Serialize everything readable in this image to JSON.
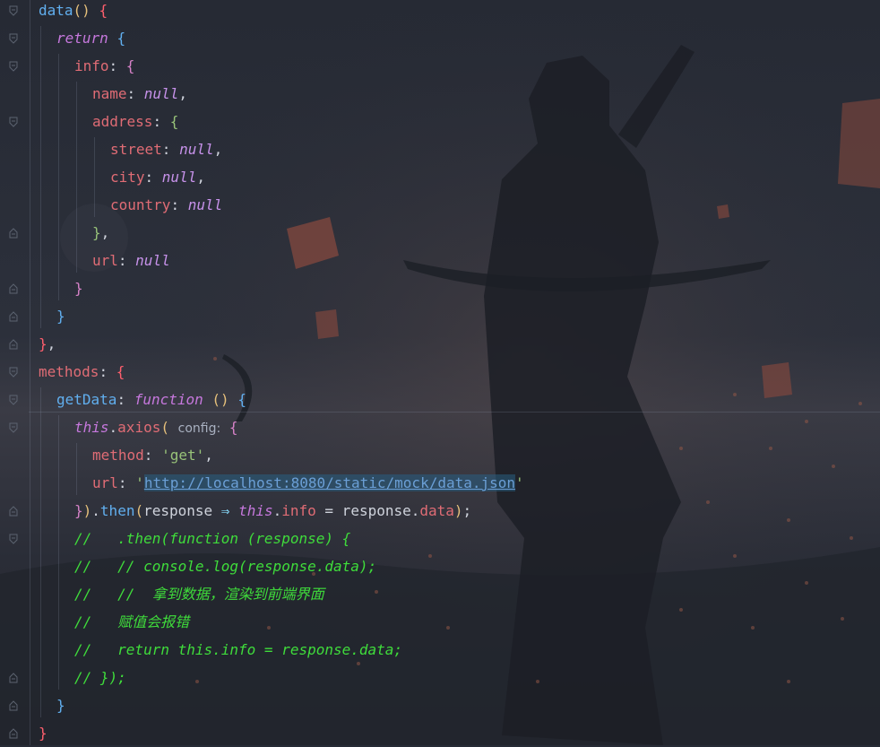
{
  "editor": {
    "language": "javascript",
    "lines": [
      [
        {
          "c": "fn",
          "t": "data"
        },
        {
          "c": "br-y",
          "t": "()"
        },
        {
          "c": "plain",
          "t": " "
        },
        {
          "c": "br-r",
          "t": "{"
        }
      ],
      [
        {
          "c": "kw",
          "t": "return"
        },
        {
          "c": "plain",
          "t": " "
        },
        {
          "c": "br-b",
          "t": "{"
        }
      ],
      [
        {
          "c": "prop",
          "t": "info"
        },
        {
          "c": "plain",
          "t": ": "
        },
        {
          "c": "br-p",
          "t": "{"
        }
      ],
      [
        {
          "c": "prop",
          "t": "name"
        },
        {
          "c": "plain",
          "t": ": "
        },
        {
          "c": "nul",
          "t": "null"
        },
        {
          "c": "plain",
          "t": ","
        }
      ],
      [
        {
          "c": "prop",
          "t": "address"
        },
        {
          "c": "plain",
          "t": ": "
        },
        {
          "c": "br-g",
          "t": "{"
        }
      ],
      [
        {
          "c": "prop",
          "t": "street"
        },
        {
          "c": "plain",
          "t": ": "
        },
        {
          "c": "nul",
          "t": "null"
        },
        {
          "c": "plain",
          "t": ","
        }
      ],
      [
        {
          "c": "prop",
          "t": "city"
        },
        {
          "c": "plain",
          "t": ": "
        },
        {
          "c": "nul",
          "t": "null"
        },
        {
          "c": "plain",
          "t": ","
        }
      ],
      [
        {
          "c": "prop",
          "t": "country"
        },
        {
          "c": "plain",
          "t": ": "
        },
        {
          "c": "nul",
          "t": "null"
        }
      ],
      [
        {
          "c": "br-g",
          "t": "}"
        },
        {
          "c": "plain",
          "t": ","
        }
      ],
      [
        {
          "c": "prop",
          "t": "url"
        },
        {
          "c": "plain",
          "t": ": "
        },
        {
          "c": "nul",
          "t": "null"
        }
      ],
      [
        {
          "c": "br-p",
          "t": "}"
        }
      ],
      [
        {
          "c": "br-b",
          "t": "}"
        }
      ],
      [
        {
          "c": "br-r",
          "t": "}"
        },
        {
          "c": "plain",
          "t": ","
        }
      ],
      [
        {
          "c": "prop",
          "t": "methods"
        },
        {
          "c": "plain",
          "t": ": "
        },
        {
          "c": "br-r",
          "t": "{"
        }
      ],
      [
        {
          "c": "fn",
          "t": "getData"
        },
        {
          "c": "plain",
          "t": ": "
        },
        {
          "c": "kw",
          "t": "function"
        },
        {
          "c": "plain",
          "t": " "
        },
        {
          "c": "br-y",
          "t": "()"
        },
        {
          "c": "plain",
          "t": " "
        },
        {
          "c": "br-b",
          "t": "{"
        }
      ],
      [
        {
          "c": "kw",
          "t": "this"
        },
        {
          "c": "plain",
          "t": "."
        },
        {
          "c": "prop",
          "t": "axios"
        },
        {
          "c": "br-y",
          "t": "("
        },
        {
          "c": "plain",
          "t": " "
        },
        {
          "c": "hint",
          "t": "config:"
        },
        {
          "c": "plain",
          "t": " "
        },
        {
          "c": "br-p",
          "t": "{"
        }
      ],
      [
        {
          "c": "prop",
          "t": "method"
        },
        {
          "c": "plain",
          "t": ": "
        },
        {
          "c": "str",
          "t": "'get'"
        },
        {
          "c": "plain",
          "t": ","
        }
      ],
      [
        {
          "c": "prop",
          "t": "url"
        },
        {
          "c": "plain",
          "t": ": "
        },
        {
          "c": "str",
          "t": "'"
        },
        {
          "c": "url-link",
          "t": "http://localhost:8080/static/mock/data.json"
        },
        {
          "c": "str",
          "t": "'"
        }
      ],
      [
        {
          "c": "br-p",
          "t": "}"
        },
        {
          "c": "br-y",
          "t": ")"
        },
        {
          "c": "plain",
          "t": "."
        },
        {
          "c": "fn",
          "t": "then"
        },
        {
          "c": "br-y",
          "t": "("
        },
        {
          "c": "plain",
          "t": "response "
        },
        {
          "c": "op",
          "t": "⇒"
        },
        {
          "c": "plain",
          "t": " "
        },
        {
          "c": "kw",
          "t": "this"
        },
        {
          "c": "plain",
          "t": "."
        },
        {
          "c": "prop",
          "t": "info"
        },
        {
          "c": "plain",
          "t": " = response."
        },
        {
          "c": "prop",
          "t": "data"
        },
        {
          "c": "br-y",
          "t": ")"
        },
        {
          "c": "plain",
          "t": ";"
        }
      ],
      [
        {
          "c": "cm",
          "t": "//   .then(function (response) {"
        }
      ],
      [
        {
          "c": "cm",
          "t": "//   // console.log(response.data);"
        }
      ],
      [
        {
          "c": "cm",
          "t": "//   //  拿到数据，渲染到前端界面"
        }
      ],
      [
        {
          "c": "cm",
          "t": "//   赋值会报错"
        }
      ],
      [
        {
          "c": "cm",
          "t": "//   return this.info = response.data;"
        }
      ],
      [
        {
          "c": "cm",
          "t": "// });"
        }
      ],
      [
        {
          "c": "br-b",
          "t": "}"
        }
      ],
      [
        {
          "c": "br-r",
          "t": "}"
        }
      ]
    ],
    "fold_icons": [
      "fold-open-icon",
      "fold-open-icon",
      "fold-open-icon",
      "none",
      "fold-open-icon",
      "none",
      "none",
      "none",
      "fold-close-icon",
      "none",
      "fold-close-icon",
      "fold-close-icon",
      "fold-close-icon",
      "fold-open-icon",
      "fold-open-icon",
      "fold-open-icon",
      "none",
      "none",
      "fold-close-icon",
      "fold-open-icon",
      "none",
      "none",
      "none",
      "none",
      "fold-close-icon",
      "fold-close-icon",
      "fold-close-icon"
    ],
    "colors": {
      "background": "#272b36",
      "property": "#e06c75",
      "function": "#61afef",
      "keyword": "#c678dd",
      "string": "#98c379",
      "comment": "#3fdc3b",
      "bracket_yellow": "#e5c07b",
      "bracket_purple": "#d682c8"
    }
  }
}
